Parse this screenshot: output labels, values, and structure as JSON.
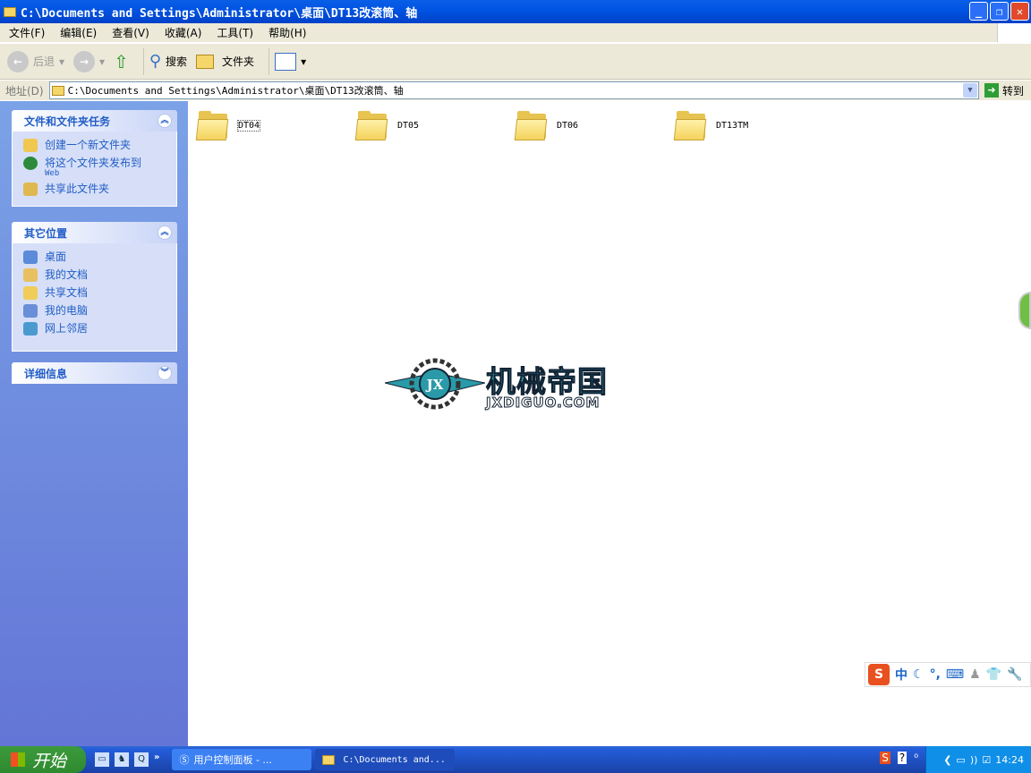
{
  "window": {
    "title": "C:\\Documents and Settings\\Administrator\\桌面\\DT13改滚筒、轴",
    "minimize": "_",
    "maximize": "❐",
    "close": "✕"
  },
  "menu": [
    "文件(F)",
    "编辑(E)",
    "查看(V)",
    "收藏(A)",
    "工具(T)",
    "帮助(H)"
  ],
  "toolbar": {
    "back": "后退",
    "search": "搜索",
    "folders": "文件夹"
  },
  "address": {
    "label": "地址(D)",
    "value": "C:\\Documents and Settings\\Administrator\\桌面\\DT13改滚筒、轴",
    "go": "转到"
  },
  "tasks": {
    "title": "文件和文件夹任务",
    "items": [
      "创建一个新文件夹",
      "将这个文件夹发布到",
      "共享此文件夹"
    ],
    "web": "Web"
  },
  "places": {
    "title": "其它位置",
    "items": [
      "桌面",
      "我的文档",
      "共享文档",
      "我的电脑",
      "网上邻居"
    ]
  },
  "details": {
    "title": "详细信息"
  },
  "folders": [
    "DT04",
    "DT05",
    "DT06",
    "DT13TM"
  ],
  "watermark": {
    "cn": "机械帝国",
    "en": "JXDIGUO.COM",
    "badge": "JX"
  },
  "ime": {
    "logo": "S",
    "mode": "中"
  },
  "taskbar": {
    "start": "开始",
    "tasks": [
      "用户控制面板 - ...",
      "C:\\Documents and..."
    ],
    "clock": "14:24"
  }
}
